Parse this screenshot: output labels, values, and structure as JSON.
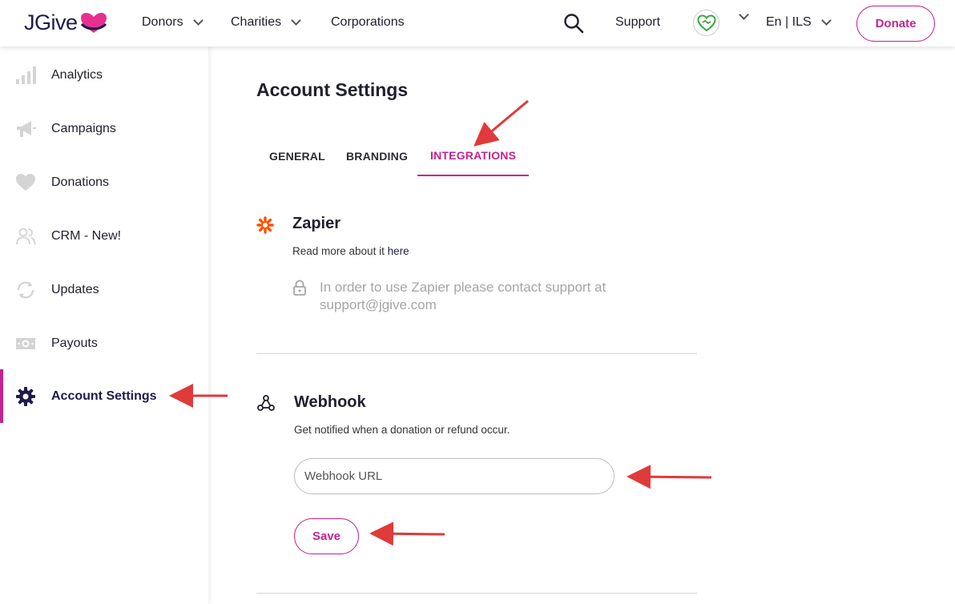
{
  "header": {
    "logo_text": "JGive",
    "nav": [
      {
        "label": "Donors"
      },
      {
        "label": "Charities"
      },
      {
        "label": "Corporations"
      }
    ],
    "support_label": "Support",
    "language_currency": "En | ILS",
    "donate_label": "Donate"
  },
  "sidebar": {
    "items": [
      {
        "label": "Analytics",
        "icon": "bar-chart-icon"
      },
      {
        "label": "Campaigns",
        "icon": "megaphone-icon"
      },
      {
        "label": "Donations",
        "icon": "heart-icon"
      },
      {
        "label": "CRM - New!",
        "icon": "people-icon"
      },
      {
        "label": "Updates",
        "icon": "refresh-icon"
      },
      {
        "label": "Payouts",
        "icon": "banknote-icon"
      },
      {
        "label": "Account Settings",
        "icon": "gear-icon",
        "active": true
      }
    ]
  },
  "main": {
    "title": "Account Settings",
    "tabs": [
      {
        "label": "GENERAL"
      },
      {
        "label": "BRANDING"
      },
      {
        "label": "INTEGRATIONS",
        "active": true
      }
    ],
    "zapier": {
      "title": "Zapier",
      "sub_prefix": "Read more about it ",
      "sub_link": "here",
      "lock_note": "In order to use Zapier please contact support at support@jgive.com"
    },
    "webhook": {
      "title": "Webhook",
      "subtitle": "Get notified when a donation or refund occur.",
      "input_placeholder": "Webhook URL",
      "input_value": "",
      "save_label": "Save"
    }
  },
  "colors": {
    "accent": "#c4238f",
    "navy": "#1e1b4b",
    "zapier_orange": "#ff4f00",
    "annotation_red": "#e03a3a"
  }
}
